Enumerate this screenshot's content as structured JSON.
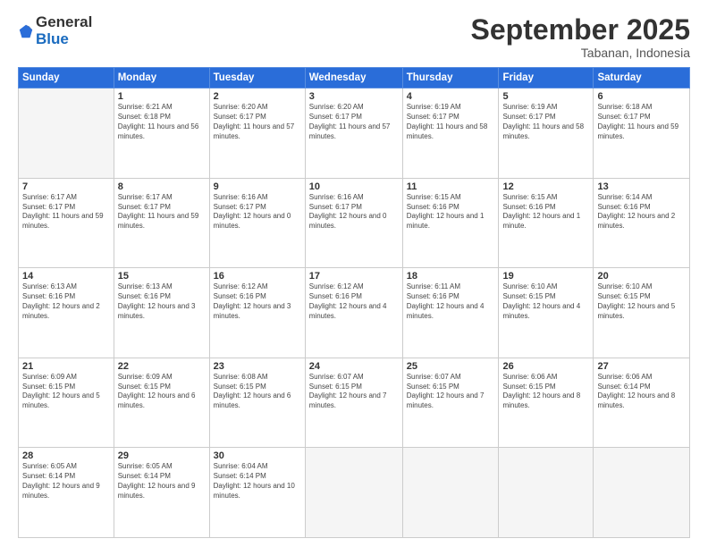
{
  "logo": {
    "general": "General",
    "blue": "Blue"
  },
  "title": "September 2025",
  "location": "Tabanan, Indonesia",
  "days_of_week": [
    "Sunday",
    "Monday",
    "Tuesday",
    "Wednesday",
    "Thursday",
    "Friday",
    "Saturday"
  ],
  "weeks": [
    [
      {
        "day": "",
        "sunrise": "",
        "sunset": "",
        "daylight": ""
      },
      {
        "day": "1",
        "sunrise": "Sunrise: 6:21 AM",
        "sunset": "Sunset: 6:18 PM",
        "daylight": "Daylight: 11 hours and 56 minutes."
      },
      {
        "day": "2",
        "sunrise": "Sunrise: 6:20 AM",
        "sunset": "Sunset: 6:17 PM",
        "daylight": "Daylight: 11 hours and 57 minutes."
      },
      {
        "day": "3",
        "sunrise": "Sunrise: 6:20 AM",
        "sunset": "Sunset: 6:17 PM",
        "daylight": "Daylight: 11 hours and 57 minutes."
      },
      {
        "day": "4",
        "sunrise": "Sunrise: 6:19 AM",
        "sunset": "Sunset: 6:17 PM",
        "daylight": "Daylight: 11 hours and 58 minutes."
      },
      {
        "day": "5",
        "sunrise": "Sunrise: 6:19 AM",
        "sunset": "Sunset: 6:17 PM",
        "daylight": "Daylight: 11 hours and 58 minutes."
      },
      {
        "day": "6",
        "sunrise": "Sunrise: 6:18 AM",
        "sunset": "Sunset: 6:17 PM",
        "daylight": "Daylight: 11 hours and 59 minutes."
      }
    ],
    [
      {
        "day": "7",
        "sunrise": "Sunrise: 6:17 AM",
        "sunset": "Sunset: 6:17 PM",
        "daylight": "Daylight: 11 hours and 59 minutes."
      },
      {
        "day": "8",
        "sunrise": "Sunrise: 6:17 AM",
        "sunset": "Sunset: 6:17 PM",
        "daylight": "Daylight: 11 hours and 59 minutes."
      },
      {
        "day": "9",
        "sunrise": "Sunrise: 6:16 AM",
        "sunset": "Sunset: 6:17 PM",
        "daylight": "Daylight: 12 hours and 0 minutes."
      },
      {
        "day": "10",
        "sunrise": "Sunrise: 6:16 AM",
        "sunset": "Sunset: 6:17 PM",
        "daylight": "Daylight: 12 hours and 0 minutes."
      },
      {
        "day": "11",
        "sunrise": "Sunrise: 6:15 AM",
        "sunset": "Sunset: 6:16 PM",
        "daylight": "Daylight: 12 hours and 1 minute."
      },
      {
        "day": "12",
        "sunrise": "Sunrise: 6:15 AM",
        "sunset": "Sunset: 6:16 PM",
        "daylight": "Daylight: 12 hours and 1 minute."
      },
      {
        "day": "13",
        "sunrise": "Sunrise: 6:14 AM",
        "sunset": "Sunset: 6:16 PM",
        "daylight": "Daylight: 12 hours and 2 minutes."
      }
    ],
    [
      {
        "day": "14",
        "sunrise": "Sunrise: 6:13 AM",
        "sunset": "Sunset: 6:16 PM",
        "daylight": "Daylight: 12 hours and 2 minutes."
      },
      {
        "day": "15",
        "sunrise": "Sunrise: 6:13 AM",
        "sunset": "Sunset: 6:16 PM",
        "daylight": "Daylight: 12 hours and 3 minutes."
      },
      {
        "day": "16",
        "sunrise": "Sunrise: 6:12 AM",
        "sunset": "Sunset: 6:16 PM",
        "daylight": "Daylight: 12 hours and 3 minutes."
      },
      {
        "day": "17",
        "sunrise": "Sunrise: 6:12 AM",
        "sunset": "Sunset: 6:16 PM",
        "daylight": "Daylight: 12 hours and 4 minutes."
      },
      {
        "day": "18",
        "sunrise": "Sunrise: 6:11 AM",
        "sunset": "Sunset: 6:16 PM",
        "daylight": "Daylight: 12 hours and 4 minutes."
      },
      {
        "day": "19",
        "sunrise": "Sunrise: 6:10 AM",
        "sunset": "Sunset: 6:15 PM",
        "daylight": "Daylight: 12 hours and 4 minutes."
      },
      {
        "day": "20",
        "sunrise": "Sunrise: 6:10 AM",
        "sunset": "Sunset: 6:15 PM",
        "daylight": "Daylight: 12 hours and 5 minutes."
      }
    ],
    [
      {
        "day": "21",
        "sunrise": "Sunrise: 6:09 AM",
        "sunset": "Sunset: 6:15 PM",
        "daylight": "Daylight: 12 hours and 5 minutes."
      },
      {
        "day": "22",
        "sunrise": "Sunrise: 6:09 AM",
        "sunset": "Sunset: 6:15 PM",
        "daylight": "Daylight: 12 hours and 6 minutes."
      },
      {
        "day": "23",
        "sunrise": "Sunrise: 6:08 AM",
        "sunset": "Sunset: 6:15 PM",
        "daylight": "Daylight: 12 hours and 6 minutes."
      },
      {
        "day": "24",
        "sunrise": "Sunrise: 6:07 AM",
        "sunset": "Sunset: 6:15 PM",
        "daylight": "Daylight: 12 hours and 7 minutes."
      },
      {
        "day": "25",
        "sunrise": "Sunrise: 6:07 AM",
        "sunset": "Sunset: 6:15 PM",
        "daylight": "Daylight: 12 hours and 7 minutes."
      },
      {
        "day": "26",
        "sunrise": "Sunrise: 6:06 AM",
        "sunset": "Sunset: 6:15 PM",
        "daylight": "Daylight: 12 hours and 8 minutes."
      },
      {
        "day": "27",
        "sunrise": "Sunrise: 6:06 AM",
        "sunset": "Sunset: 6:14 PM",
        "daylight": "Daylight: 12 hours and 8 minutes."
      }
    ],
    [
      {
        "day": "28",
        "sunrise": "Sunrise: 6:05 AM",
        "sunset": "Sunset: 6:14 PM",
        "daylight": "Daylight: 12 hours and 9 minutes."
      },
      {
        "day": "29",
        "sunrise": "Sunrise: 6:05 AM",
        "sunset": "Sunset: 6:14 PM",
        "daylight": "Daylight: 12 hours and 9 minutes."
      },
      {
        "day": "30",
        "sunrise": "Sunrise: 6:04 AM",
        "sunset": "Sunset: 6:14 PM",
        "daylight": "Daylight: 12 hours and 10 minutes."
      },
      {
        "day": "",
        "sunrise": "",
        "sunset": "",
        "daylight": ""
      },
      {
        "day": "",
        "sunrise": "",
        "sunset": "",
        "daylight": ""
      },
      {
        "day": "",
        "sunrise": "",
        "sunset": "",
        "daylight": ""
      },
      {
        "day": "",
        "sunrise": "",
        "sunset": "",
        "daylight": ""
      }
    ]
  ]
}
